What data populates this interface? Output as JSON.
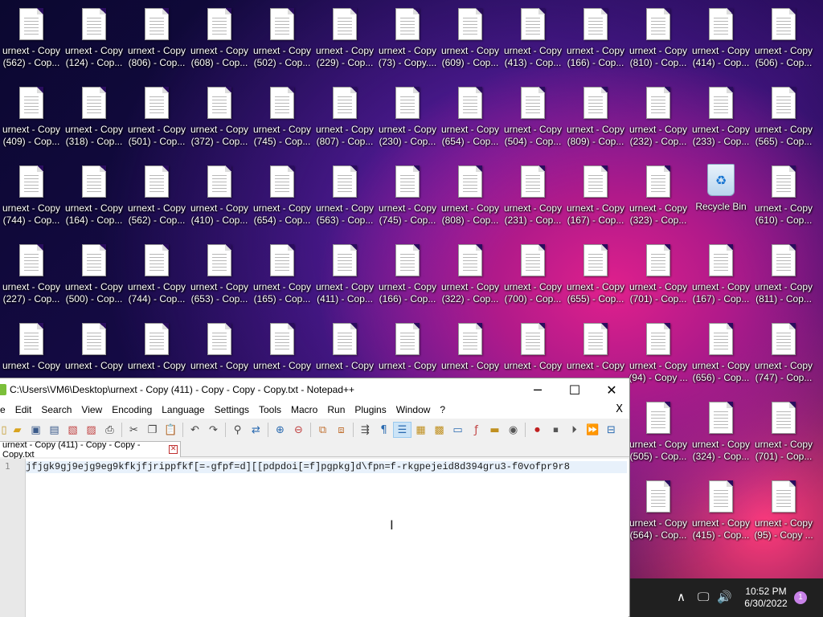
{
  "desktop": {
    "icons": [
      {
        "l1": "urnext - Copy",
        "l2": "(562) - Cop..."
      },
      {
        "l1": "urnext - Copy",
        "l2": "(124) - Cop..."
      },
      {
        "l1": "urnext - Copy",
        "l2": "(806) - Cop..."
      },
      {
        "l1": "urnext - Copy",
        "l2": "(608) - Cop..."
      },
      {
        "l1": "urnext - Copy",
        "l2": "(502) - Cop..."
      },
      {
        "l1": "urnext - Copy",
        "l2": "(229) - Cop..."
      },
      {
        "l1": "urnext - Copy",
        "l2": "(73) - Copy...."
      },
      {
        "l1": "urnext - Copy",
        "l2": "(609) - Cop..."
      },
      {
        "l1": "urnext - Copy",
        "l2": "(413) - Cop..."
      },
      {
        "l1": "urnext - Copy",
        "l2": "(166) - Cop..."
      },
      {
        "l1": "urnext - Copy",
        "l2": "(810) - Cop..."
      },
      {
        "l1": "urnext - Copy",
        "l2": "(414) - Cop..."
      },
      {
        "l1": "urnext - Copy",
        "l2": "(506) - Cop..."
      },
      {
        "l1": "urnext - Copy",
        "l2": "(409) - Cop..."
      },
      {
        "l1": "urnext - Copy",
        "l2": "(318) - Cop..."
      },
      {
        "l1": "urnext - Copy",
        "l2": "(501) - Cop..."
      },
      {
        "l1": "urnext - Copy",
        "l2": "(372) - Cop..."
      },
      {
        "l1": "urnext - Copy",
        "l2": "(745) - Cop..."
      },
      {
        "l1": "urnext - Copy",
        "l2": "(807) - Cop..."
      },
      {
        "l1": "urnext - Copy",
        "l2": "(230) - Cop..."
      },
      {
        "l1": "urnext - Copy",
        "l2": "(654) - Cop..."
      },
      {
        "l1": "urnext - Copy",
        "l2": "(504) - Cop..."
      },
      {
        "l1": "urnext - Copy",
        "l2": "(809) - Cop..."
      },
      {
        "l1": "urnext - Copy",
        "l2": "(232) - Cop..."
      },
      {
        "l1": "urnext - Copy",
        "l2": "(233) - Cop..."
      },
      {
        "l1": "urnext - Copy",
        "l2": "(565) - Cop..."
      },
      {
        "l1": "urnext - Copy",
        "l2": "(744) - Cop..."
      },
      {
        "l1": "urnext - Copy",
        "l2": "(164) - Cop..."
      },
      {
        "l1": "urnext - Copy",
        "l2": "(562) - Cop..."
      },
      {
        "l1": "urnext - Copy",
        "l2": "(410) - Cop..."
      },
      {
        "l1": "urnext - Copy",
        "l2": "(654) - Cop..."
      },
      {
        "l1": "urnext - Copy",
        "l2": "(563) - Cop..."
      },
      {
        "l1": "urnext - Copy",
        "l2": "(745) - Cop..."
      },
      {
        "l1": "urnext - Copy",
        "l2": "(808) - Cop..."
      },
      {
        "l1": "urnext - Copy",
        "l2": "(231) - Cop..."
      },
      {
        "l1": "urnext - Copy",
        "l2": "(167) - Cop..."
      },
      {
        "l1": "urnext - Copy",
        "l2": "(323) - Cop..."
      },
      {
        "l1": "Recycle Bin",
        "l2": "",
        "recycle": true
      },
      {
        "l1": "urnext - Copy",
        "l2": "(610) - Cop..."
      },
      {
        "l1": "urnext - Copy",
        "l2": "(227) - Cop..."
      },
      {
        "l1": "urnext - Copy",
        "l2": "(500) - Cop..."
      },
      {
        "l1": "urnext - Copy",
        "l2": "(744) - Cop..."
      },
      {
        "l1": "urnext - Copy",
        "l2": "(653) - Cop..."
      },
      {
        "l1": "urnext - Copy",
        "l2": "(165) - Cop..."
      },
      {
        "l1": "urnext - Copy",
        "l2": "(411) - Cop..."
      },
      {
        "l1": "urnext - Copy",
        "l2": "(166) - Cop..."
      },
      {
        "l1": "urnext - Copy",
        "l2": "(322) - Cop..."
      },
      {
        "l1": "urnext - Copy",
        "l2": "(700) - Cop..."
      },
      {
        "l1": "urnext - Copy",
        "l2": "(655) - Cop..."
      },
      {
        "l1": "urnext - Copy",
        "l2": "(701) - Cop..."
      },
      {
        "l1": "urnext - Copy",
        "l2": "(167) - Cop..."
      },
      {
        "l1": "urnext - Copy",
        "l2": "(811) - Cop..."
      },
      {
        "l1": "urnext - Copy",
        "l2": ""
      },
      {
        "l1": "urnext - Copy",
        "l2": ""
      },
      {
        "l1": "urnext - Copy",
        "l2": ""
      },
      {
        "l1": "urnext - Copy",
        "l2": ""
      },
      {
        "l1": "urnext - Copy",
        "l2": ""
      },
      {
        "l1": "urnext - Copy",
        "l2": ""
      },
      {
        "l1": "urnext - Copy",
        "l2": ""
      },
      {
        "l1": "urnext - Copy",
        "l2": ""
      },
      {
        "l1": "urnext - Copy",
        "l2": ""
      },
      {
        "l1": "urnext - Copy",
        "l2": ""
      },
      {
        "l1": "urnext - Copy",
        "l2": "(94) - Copy ..."
      },
      {
        "l1": "urnext - Copy",
        "l2": "(656) - Cop..."
      },
      {
        "l1": "urnext - Copy",
        "l2": "(747) - Cop..."
      },
      {
        "l1": "urnext - Copy",
        "l2": "(505) - Cop..."
      },
      {
        "l1": "urnext - Copy",
        "l2": "(324) - Cop..."
      },
      {
        "l1": "urnext - Copy",
        "l2": "(701) - Cop..."
      },
      {
        "l1": "urnext - Copy",
        "l2": "(564) - Cop..."
      },
      {
        "l1": "urnext - Copy",
        "l2": "(415) - Cop..."
      },
      {
        "l1": "urnext - Copy",
        "l2": "(95) - Copy ..."
      }
    ]
  },
  "notepad": {
    "title": "C:\\Users\\VM6\\Desktop\\urnext - Copy (411) - Copy - Copy - Copy.txt - Notepad++",
    "window_buttons": {
      "minimize": "─",
      "maximize": "☐",
      "close": "✕"
    },
    "menu": [
      "e",
      "Edit",
      "Search",
      "View",
      "Encoding",
      "Language",
      "Settings",
      "Tools",
      "Macro",
      "Run",
      "Plugins",
      "Window",
      "?"
    ],
    "menu_close": "X",
    "tab_label": "urnext - Copy (411) - Copy - Copy - Copy.txt",
    "tab_close": "✕",
    "line_number": "1",
    "content": "jfjgk9gj9ejg9eg9kfkjfjrippfkf[=-gfpf=d][[pdpdoi[=f]pgpkg]d\\fpn=f-rkgpejeid8d394gru3-f0vofpr9r8"
  },
  "taskbar": {
    "chevron": "∧",
    "network": "🖵",
    "volume": "🔊",
    "time": "10:52 PM",
    "date": "6/30/2022",
    "notifications": "1"
  }
}
